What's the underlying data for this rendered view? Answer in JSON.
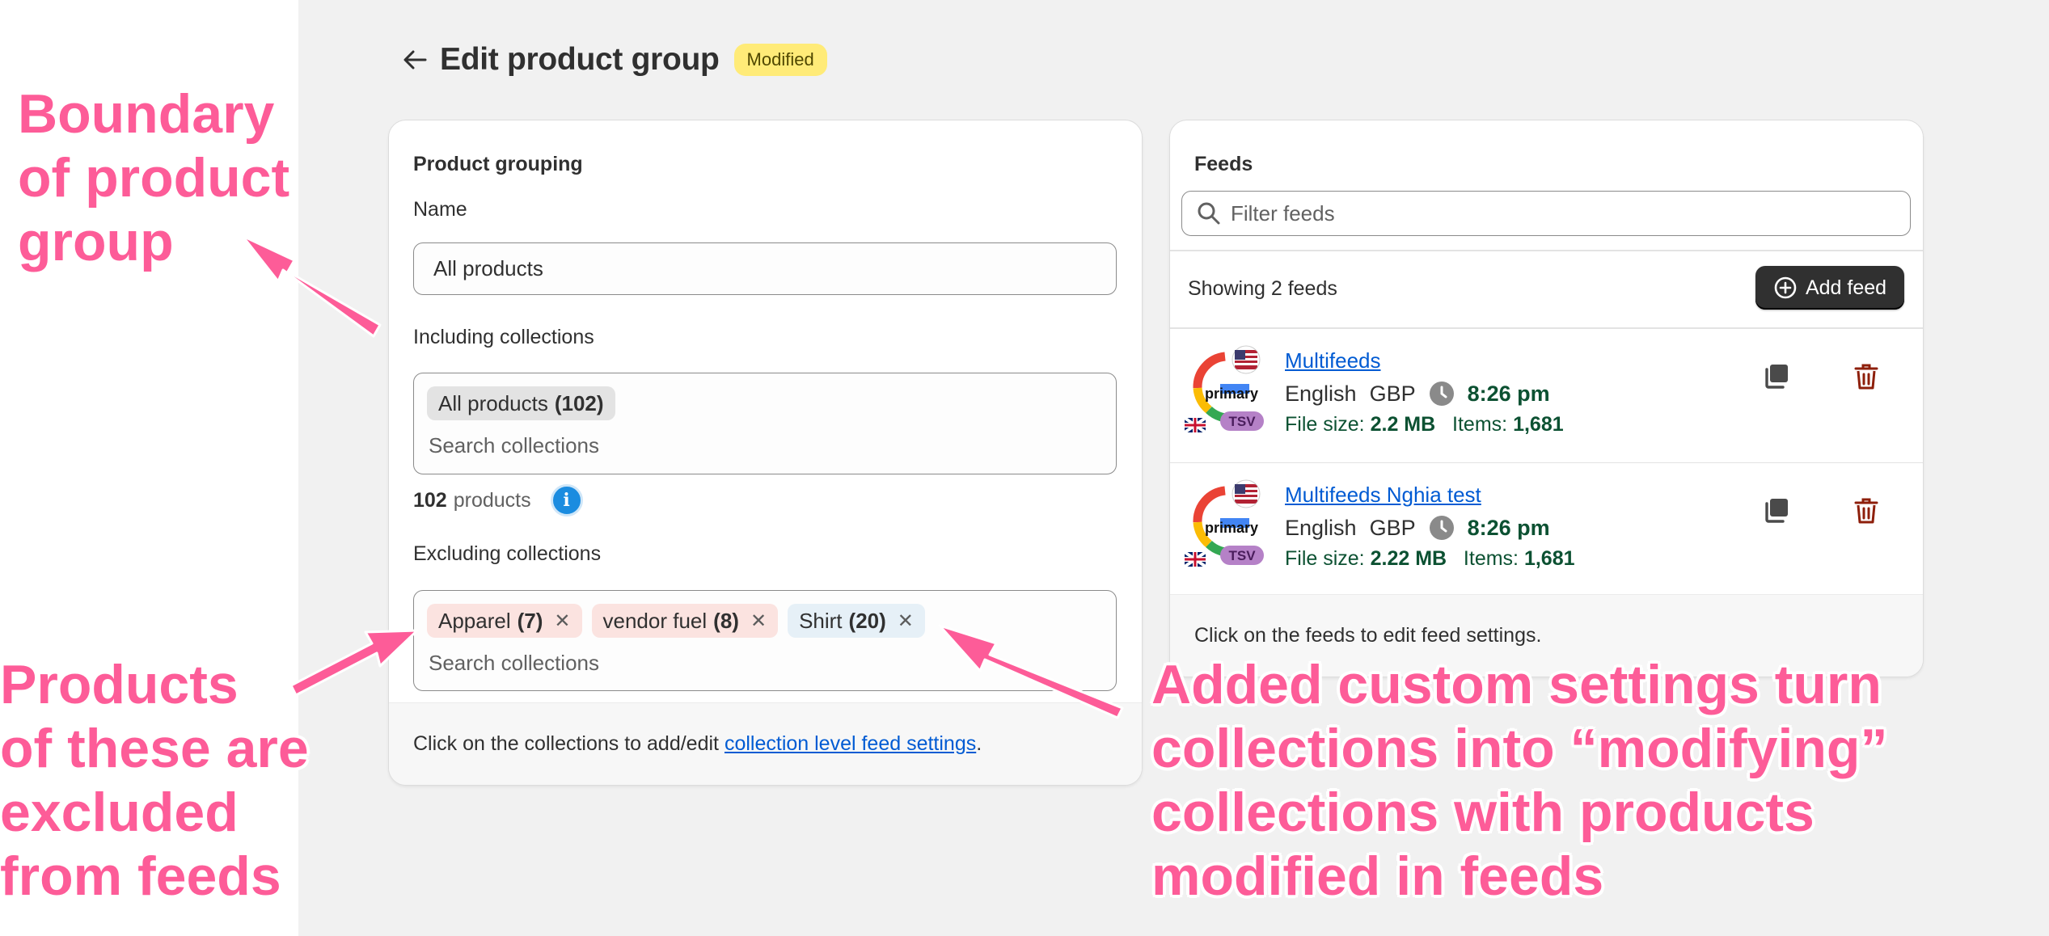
{
  "header": {
    "title": "Edit product group",
    "status_badge": "Modified"
  },
  "product_grouping": {
    "section_title": "Product grouping",
    "name_label": "Name",
    "name_value": "All products",
    "including_label": "Including collections",
    "including_tags": [
      {
        "name": "All products",
        "count": "(102)"
      }
    ],
    "including_search_placeholder": "Search collections",
    "product_count_number": "102",
    "product_count_suffix": "products",
    "excluding_label": "Excluding collections",
    "excluding_tags": [
      {
        "name": "Apparel",
        "count": "(7)",
        "color": "#fbe3e0"
      },
      {
        "name": "vendor fuel",
        "count": "(8)",
        "color": "#fbe3e0"
      },
      {
        "name": "Shirt",
        "count": "(20)",
        "color": "#e6f0f7"
      }
    ],
    "excluding_search_placeholder": "Search collections",
    "footer_text": "Click on the collections to add/edit",
    "footer_link": "collection level feed settings",
    "footer_end": "."
  },
  "feeds": {
    "section_title": "Feeds",
    "filter_placeholder": "Filter feeds",
    "showing_text": "Showing 2 feeds",
    "add_feed_label": "Add feed",
    "logo_primary_label": "primary",
    "logo_format_label": "TSV",
    "items": [
      {
        "name": "Multifeeds",
        "language": "English",
        "currency": "GBP",
        "time": "8:26 pm",
        "file_size_label": "File size:",
        "file_size": "2.2 MB",
        "items_label": "Items:",
        "items": "1,681"
      },
      {
        "name": "Multifeeds Nghia test",
        "language": "English",
        "currency": "GBP",
        "time": "8:26 pm",
        "file_size_label": "File size:",
        "file_size": "2.22 MB",
        "items_label": "Items:",
        "items": "1,681"
      }
    ],
    "footer_text": "Click on the feeds to edit feed settings."
  },
  "annotations": {
    "boundary": [
      "Boundary",
      "of product",
      "group"
    ],
    "excluded": [
      "Products",
      "of these are",
      "excluded",
      "from feeds"
    ],
    "modifying": [
      "Added custom settings turn",
      "collections into “modifying”",
      "collections with products",
      "modified in feeds"
    ],
    "color": "#fd5c98"
  },
  "colors": {
    "link": "#005bd3",
    "badge": "#ffeb78",
    "delete": "#8e1f0b",
    "success_text": "#0c5132"
  }
}
